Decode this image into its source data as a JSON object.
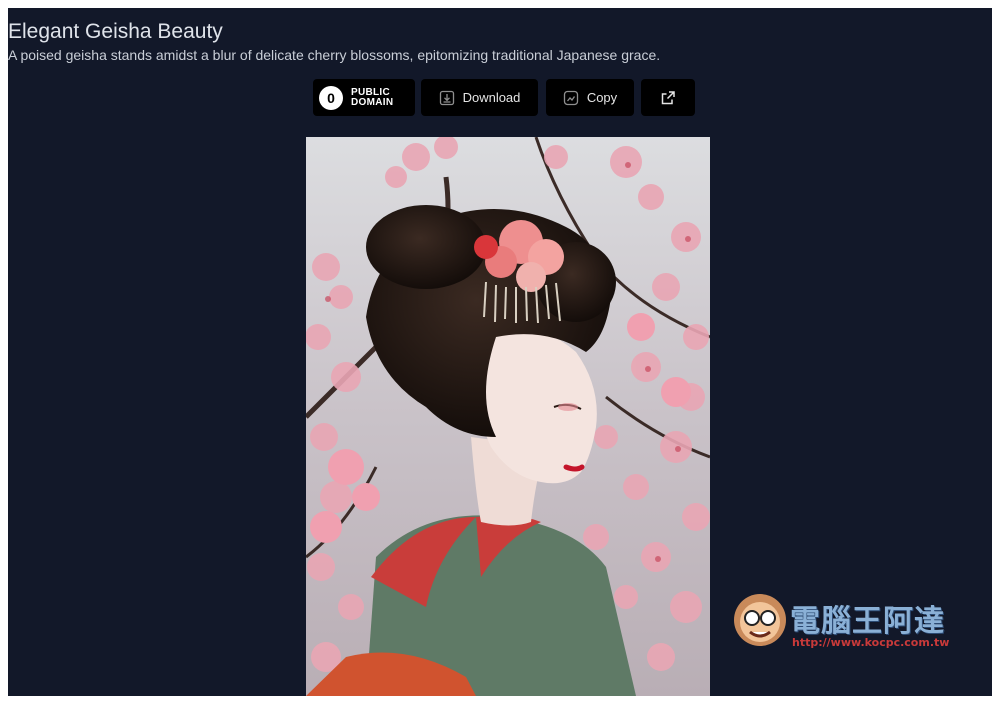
{
  "header": {
    "title": "Elegant Geisha Beauty",
    "description": "A poised geisha stands amidst a blur of delicate cherry blossoms, epitomizing traditional Japanese grace."
  },
  "toolbar": {
    "license_line1": "PUBLIC",
    "license_line2": "DOMAIN",
    "license_symbol": "0",
    "download_label": "Download",
    "copy_label": "Copy"
  },
  "watermark": {
    "brand": "電腦王阿達",
    "url": "http://www.kocpc.com.tw"
  },
  "colors": {
    "background": "#121829",
    "button": "#000000",
    "kimono": "#5f7a66",
    "blossom": "#e9a6b4"
  }
}
